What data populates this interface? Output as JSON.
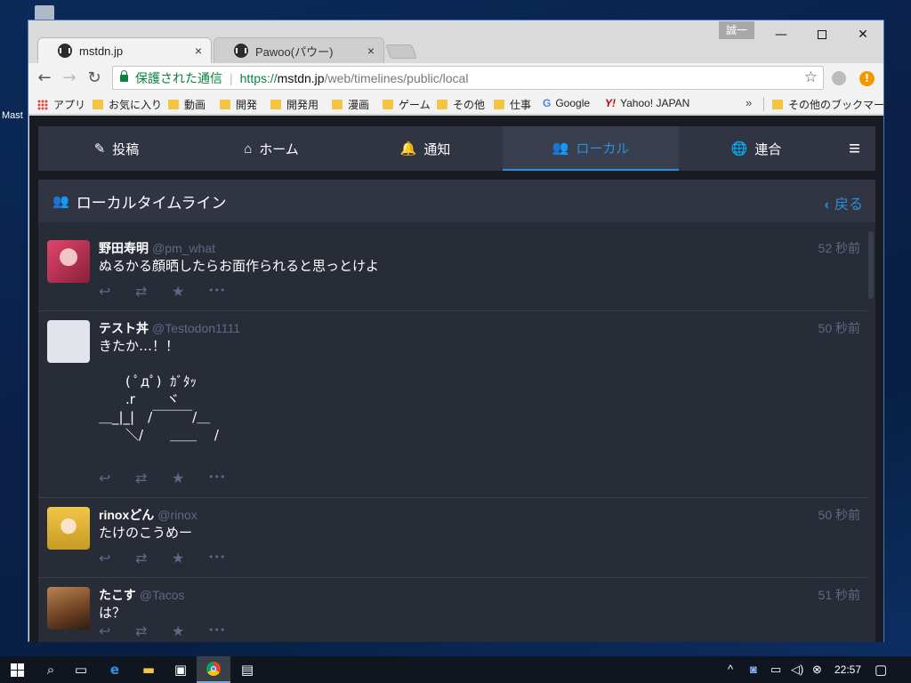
{
  "desktop": {
    "icon_label": "Mast"
  },
  "browser": {
    "tabs": [
      {
        "title": "mstdn.jp",
        "close": "×"
      },
      {
        "title": "Pawoo(パウー)",
        "close": "×"
      }
    ],
    "user_badge": "誠一",
    "window_controls": {
      "minimize": "—",
      "close": "✕"
    },
    "nav": {
      "back": "←",
      "forward": "→",
      "reload": "↻"
    },
    "omnibox": {
      "secure_label": "保護された通信",
      "separator": "|",
      "url_proto": "https://",
      "url_host": "mstdn.jp",
      "url_path": "/web/timelines/public/local",
      "star": "☆"
    },
    "ext_warning": "!",
    "bookmarks": [
      {
        "label": "アプリ",
        "kind": "apps"
      },
      {
        "label": "お気に入り",
        "kind": "folder"
      },
      {
        "label": "動画",
        "kind": "folder"
      },
      {
        "label": "開発",
        "kind": "folder"
      },
      {
        "label": "開発用",
        "kind": "folder"
      },
      {
        "label": "漫画",
        "kind": "folder"
      },
      {
        "label": "ゲーム",
        "kind": "folder"
      },
      {
        "label": "その他",
        "kind": "folder"
      },
      {
        "label": "仕事",
        "kind": "folder"
      },
      {
        "label": "Google",
        "kind": "google",
        "glyph": "G"
      },
      {
        "label": "Yahoo! JAPAN",
        "kind": "yahoo",
        "glyph": "Y!"
      }
    ],
    "bookmarks_more": "»",
    "other_bookmarks": "その他のブックマーク"
  },
  "mastodon": {
    "nav_tabs": [
      {
        "label": "投稿",
        "icon": "pencil-icon",
        "glyph": "✎"
      },
      {
        "label": "ホーム",
        "icon": "home-icon",
        "glyph": "⌂"
      },
      {
        "label": "通知",
        "icon": "bell-icon",
        "glyph": "🔔"
      },
      {
        "label": "ローカル",
        "icon": "users-icon",
        "glyph": "👥"
      },
      {
        "label": "連合",
        "icon": "globe-icon",
        "glyph": "🌐"
      }
    ],
    "menu_glyph": "≡",
    "column_title": "ローカルタイムライン",
    "column_icon_glyph": "👥",
    "back_label": "戻る",
    "back_glyph": "‹",
    "statuses": [
      {
        "display_name": "野田寿明",
        "acct": "@pm_what",
        "time": "52 秒前",
        "content": "ぬるかる顔晒したらお面作られると思っとけよ",
        "avatar_color": "#c63b5a"
      },
      {
        "display_name": "テスト丼",
        "acct": "@Testodon1111",
        "time": "50 秒前",
        "content": "きたか…！！\n\n　　( ﾟдﾟ)  ｶﾞﾀｯ\n　　.r　　 ヾ\n＿_|_|　/￣￣￣/＿\n　　＼/　　＿＿ 　/",
        "avatar_color": "#e1e4ea"
      },
      {
        "display_name": "rinoxどん",
        "acct": "@rinox",
        "time": "50 秒前",
        "content": "たけのこうめー",
        "avatar_color": "#e8c34a"
      },
      {
        "display_name": "たこす",
        "acct": "@Tacos",
        "time": "51 秒前",
        "content": "は？",
        "avatar_color": "#7a4a2a"
      }
    ],
    "action_glyphs": {
      "reply": "↩",
      "boost": "⇄",
      "favourite": "★",
      "more": "•••"
    }
  },
  "taskbar": {
    "clock": "22:57"
  }
}
